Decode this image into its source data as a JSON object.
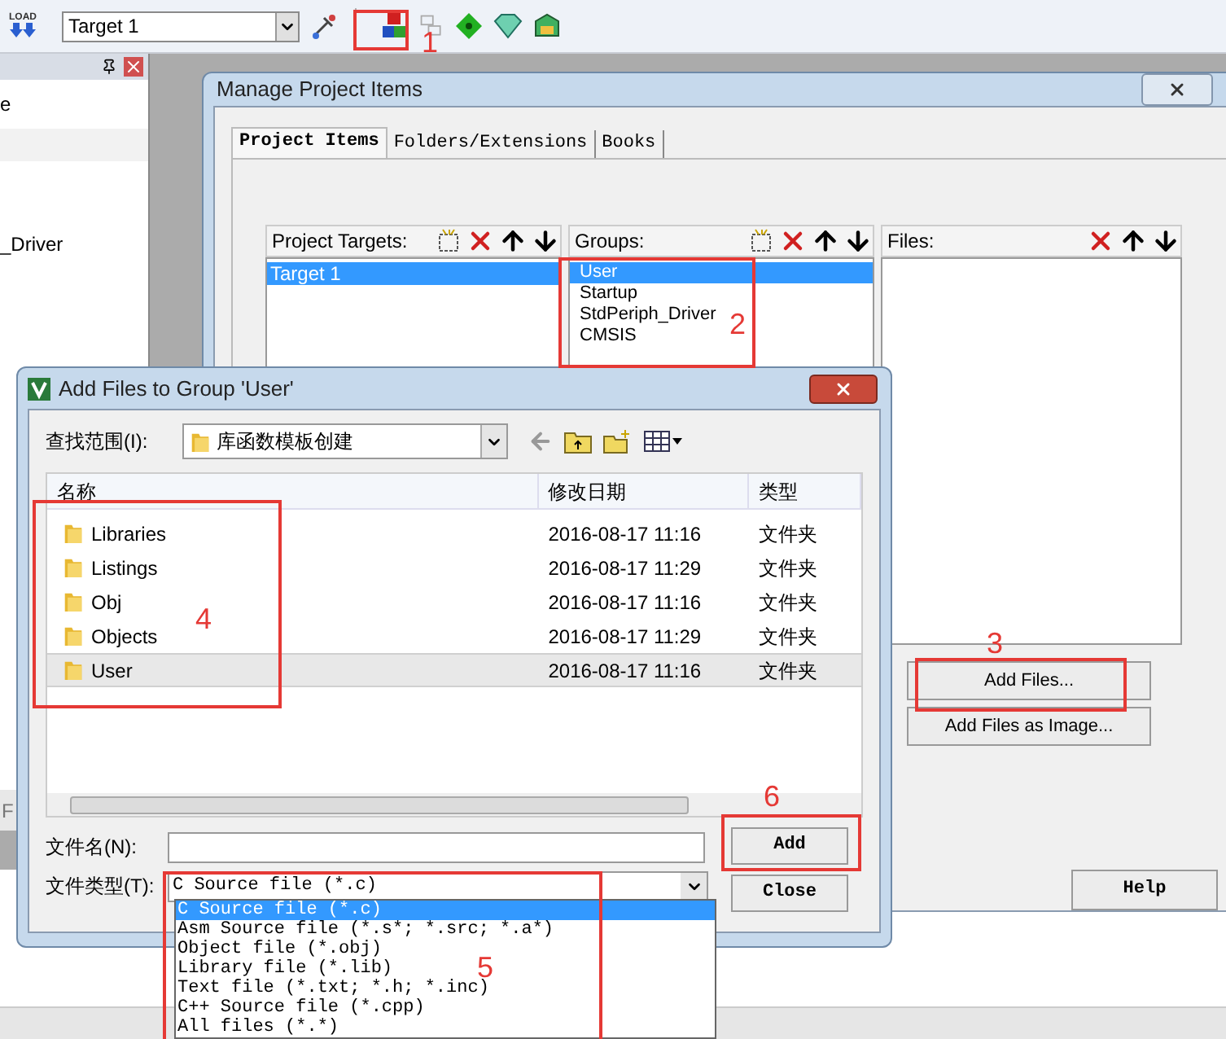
{
  "toolbar": {
    "load_label": "LOAD",
    "target": "Target 1"
  },
  "side_panel": {
    "items": [
      "e",
      "_Driver"
    ],
    "footer_text": "F"
  },
  "manage_dialog": {
    "title": "Manage Project Items",
    "tabs": [
      {
        "label": "Project Items",
        "selected": true
      },
      {
        "label": "Folders/Extensions",
        "selected": false
      },
      {
        "label": "Books",
        "selected": false
      }
    ],
    "targets": {
      "label": "Project Targets:",
      "items": [
        {
          "label": "Target 1",
          "selected": true
        }
      ]
    },
    "groups": {
      "label": "Groups:",
      "items": [
        {
          "label": "User",
          "selected": true
        },
        {
          "label": "Startup",
          "selected": false
        },
        {
          "label": "StdPeriph_Driver",
          "selected": false
        },
        {
          "label": "CMSIS",
          "selected": false
        }
      ]
    },
    "files": {
      "label": "Files:"
    },
    "add_files": "Add Files...",
    "add_image": "Add Files as Image...",
    "help": "Help"
  },
  "add_dialog": {
    "title": "Add Files to Group 'User'",
    "look_in_label": "查找范围(I):",
    "look_in": "库函数模板创建",
    "columns": [
      "名称",
      "修改日期",
      "类型"
    ],
    "rows": [
      {
        "name": "Libraries",
        "date": "2016-08-17 11:16",
        "type": "文件夹",
        "selected": false
      },
      {
        "name": "Listings",
        "date": "2016-08-17 11:29",
        "type": "文件夹",
        "selected": false
      },
      {
        "name": "Obj",
        "date": "2016-08-17 11:16",
        "type": "文件夹",
        "selected": false
      },
      {
        "name": "Objects",
        "date": "2016-08-17 11:29",
        "type": "文件夹",
        "selected": false
      },
      {
        "name": "User",
        "date": "2016-08-17 11:16",
        "type": "文件夹",
        "selected": true
      }
    ],
    "file_name_label": "文件名(N):",
    "file_type_label": "文件类型(T):",
    "file_type": "C Source file (*.c)",
    "file_types": [
      {
        "label": "C Source file (*.c)",
        "selected": true
      },
      {
        "label": "Asm Source file (*.s*; *.src; *.a*)",
        "selected": false
      },
      {
        "label": "Object file (*.obj)",
        "selected": false
      },
      {
        "label": "Library file (*.lib)",
        "selected": false
      },
      {
        "label": "Text file (*.txt; *.h; *.inc)",
        "selected": false
      },
      {
        "label": "C++ Source file (*.cpp)",
        "selected": false
      },
      {
        "label": "All files (*.*)",
        "selected": false
      }
    ],
    "add": "Add",
    "close": "Close"
  },
  "annotations": [
    "1",
    "2",
    "3",
    "4",
    "5",
    "6"
  ]
}
